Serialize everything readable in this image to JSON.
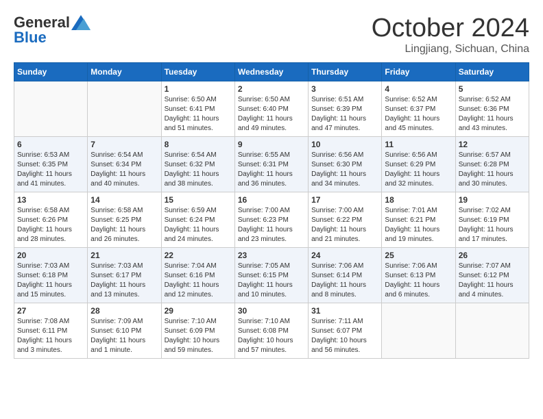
{
  "logo": {
    "general": "General",
    "blue": "Blue"
  },
  "title": {
    "month": "October 2024",
    "location": "Lingjiang, Sichuan, China"
  },
  "weekdays": [
    "Sunday",
    "Monday",
    "Tuesday",
    "Wednesday",
    "Thursday",
    "Friday",
    "Saturday"
  ],
  "weeks": [
    [
      {
        "day": "",
        "sunrise": "",
        "sunset": "",
        "daylight": ""
      },
      {
        "day": "",
        "sunrise": "",
        "sunset": "",
        "daylight": ""
      },
      {
        "day": "1",
        "sunrise": "Sunrise: 6:50 AM",
        "sunset": "Sunset: 6:41 PM",
        "daylight": "Daylight: 11 hours and 51 minutes."
      },
      {
        "day": "2",
        "sunrise": "Sunrise: 6:50 AM",
        "sunset": "Sunset: 6:40 PM",
        "daylight": "Daylight: 11 hours and 49 minutes."
      },
      {
        "day": "3",
        "sunrise": "Sunrise: 6:51 AM",
        "sunset": "Sunset: 6:39 PM",
        "daylight": "Daylight: 11 hours and 47 minutes."
      },
      {
        "day": "4",
        "sunrise": "Sunrise: 6:52 AM",
        "sunset": "Sunset: 6:37 PM",
        "daylight": "Daylight: 11 hours and 45 minutes."
      },
      {
        "day": "5",
        "sunrise": "Sunrise: 6:52 AM",
        "sunset": "Sunset: 6:36 PM",
        "daylight": "Daylight: 11 hours and 43 minutes."
      }
    ],
    [
      {
        "day": "6",
        "sunrise": "Sunrise: 6:53 AM",
        "sunset": "Sunset: 6:35 PM",
        "daylight": "Daylight: 11 hours and 41 minutes."
      },
      {
        "day": "7",
        "sunrise": "Sunrise: 6:54 AM",
        "sunset": "Sunset: 6:34 PM",
        "daylight": "Daylight: 11 hours and 40 minutes."
      },
      {
        "day": "8",
        "sunrise": "Sunrise: 6:54 AM",
        "sunset": "Sunset: 6:32 PM",
        "daylight": "Daylight: 11 hours and 38 minutes."
      },
      {
        "day": "9",
        "sunrise": "Sunrise: 6:55 AM",
        "sunset": "Sunset: 6:31 PM",
        "daylight": "Daylight: 11 hours and 36 minutes."
      },
      {
        "day": "10",
        "sunrise": "Sunrise: 6:56 AM",
        "sunset": "Sunset: 6:30 PM",
        "daylight": "Daylight: 11 hours and 34 minutes."
      },
      {
        "day": "11",
        "sunrise": "Sunrise: 6:56 AM",
        "sunset": "Sunset: 6:29 PM",
        "daylight": "Daylight: 11 hours and 32 minutes."
      },
      {
        "day": "12",
        "sunrise": "Sunrise: 6:57 AM",
        "sunset": "Sunset: 6:28 PM",
        "daylight": "Daylight: 11 hours and 30 minutes."
      }
    ],
    [
      {
        "day": "13",
        "sunrise": "Sunrise: 6:58 AM",
        "sunset": "Sunset: 6:26 PM",
        "daylight": "Daylight: 11 hours and 28 minutes."
      },
      {
        "day": "14",
        "sunrise": "Sunrise: 6:58 AM",
        "sunset": "Sunset: 6:25 PM",
        "daylight": "Daylight: 11 hours and 26 minutes."
      },
      {
        "day": "15",
        "sunrise": "Sunrise: 6:59 AM",
        "sunset": "Sunset: 6:24 PM",
        "daylight": "Daylight: 11 hours and 24 minutes."
      },
      {
        "day": "16",
        "sunrise": "Sunrise: 7:00 AM",
        "sunset": "Sunset: 6:23 PM",
        "daylight": "Daylight: 11 hours and 23 minutes."
      },
      {
        "day": "17",
        "sunrise": "Sunrise: 7:00 AM",
        "sunset": "Sunset: 6:22 PM",
        "daylight": "Daylight: 11 hours and 21 minutes."
      },
      {
        "day": "18",
        "sunrise": "Sunrise: 7:01 AM",
        "sunset": "Sunset: 6:21 PM",
        "daylight": "Daylight: 11 hours and 19 minutes."
      },
      {
        "day": "19",
        "sunrise": "Sunrise: 7:02 AM",
        "sunset": "Sunset: 6:19 PM",
        "daylight": "Daylight: 11 hours and 17 minutes."
      }
    ],
    [
      {
        "day": "20",
        "sunrise": "Sunrise: 7:03 AM",
        "sunset": "Sunset: 6:18 PM",
        "daylight": "Daylight: 11 hours and 15 minutes."
      },
      {
        "day": "21",
        "sunrise": "Sunrise: 7:03 AM",
        "sunset": "Sunset: 6:17 PM",
        "daylight": "Daylight: 11 hours and 13 minutes."
      },
      {
        "day": "22",
        "sunrise": "Sunrise: 7:04 AM",
        "sunset": "Sunset: 6:16 PM",
        "daylight": "Daylight: 11 hours and 12 minutes."
      },
      {
        "day": "23",
        "sunrise": "Sunrise: 7:05 AM",
        "sunset": "Sunset: 6:15 PM",
        "daylight": "Daylight: 11 hours and 10 minutes."
      },
      {
        "day": "24",
        "sunrise": "Sunrise: 7:06 AM",
        "sunset": "Sunset: 6:14 PM",
        "daylight": "Daylight: 11 hours and 8 minutes."
      },
      {
        "day": "25",
        "sunrise": "Sunrise: 7:06 AM",
        "sunset": "Sunset: 6:13 PM",
        "daylight": "Daylight: 11 hours and 6 minutes."
      },
      {
        "day": "26",
        "sunrise": "Sunrise: 7:07 AM",
        "sunset": "Sunset: 6:12 PM",
        "daylight": "Daylight: 11 hours and 4 minutes."
      }
    ],
    [
      {
        "day": "27",
        "sunrise": "Sunrise: 7:08 AM",
        "sunset": "Sunset: 6:11 PM",
        "daylight": "Daylight: 11 hours and 3 minutes."
      },
      {
        "day": "28",
        "sunrise": "Sunrise: 7:09 AM",
        "sunset": "Sunset: 6:10 PM",
        "daylight": "Daylight: 11 hours and 1 minute."
      },
      {
        "day": "29",
        "sunrise": "Sunrise: 7:10 AM",
        "sunset": "Sunset: 6:09 PM",
        "daylight": "Daylight: 10 hours and 59 minutes."
      },
      {
        "day": "30",
        "sunrise": "Sunrise: 7:10 AM",
        "sunset": "Sunset: 6:08 PM",
        "daylight": "Daylight: 10 hours and 57 minutes."
      },
      {
        "day": "31",
        "sunrise": "Sunrise: 7:11 AM",
        "sunset": "Sunset: 6:07 PM",
        "daylight": "Daylight: 10 hours and 56 minutes."
      },
      {
        "day": "",
        "sunrise": "",
        "sunset": "",
        "daylight": ""
      },
      {
        "day": "",
        "sunrise": "",
        "sunset": "",
        "daylight": ""
      }
    ]
  ]
}
